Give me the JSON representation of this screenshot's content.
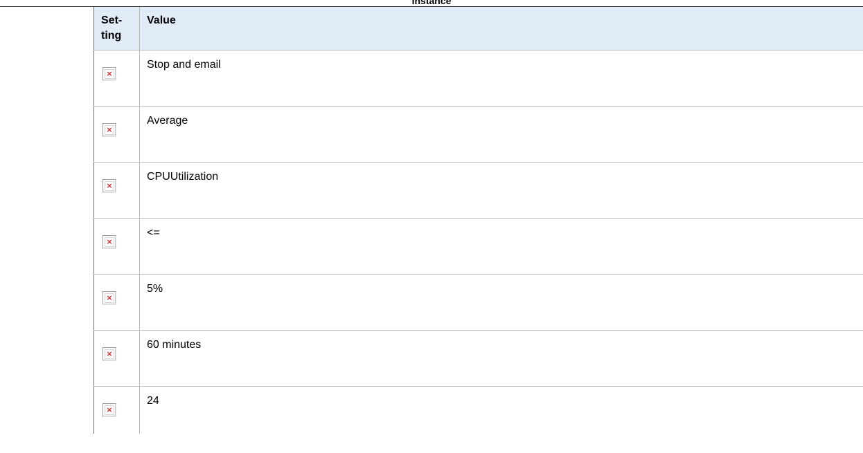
{
  "caption": "Instance",
  "table": {
    "headers": {
      "setting": "Set-\nting",
      "value": "Value"
    },
    "rows": [
      {
        "value": "Stop and email"
      },
      {
        "value": "Average"
      },
      {
        "value": "CPUUtilization"
      },
      {
        "value": "<="
      },
      {
        "value": "5%"
      },
      {
        "value": "60 minutes"
      },
      {
        "value": "24"
      }
    ]
  },
  "icons": {
    "setting_image": "broken-image-icon"
  },
  "colors": {
    "header_bg": "#e1ecf8",
    "broken_x": "#e02020",
    "grid": "#b9b9b9"
  }
}
